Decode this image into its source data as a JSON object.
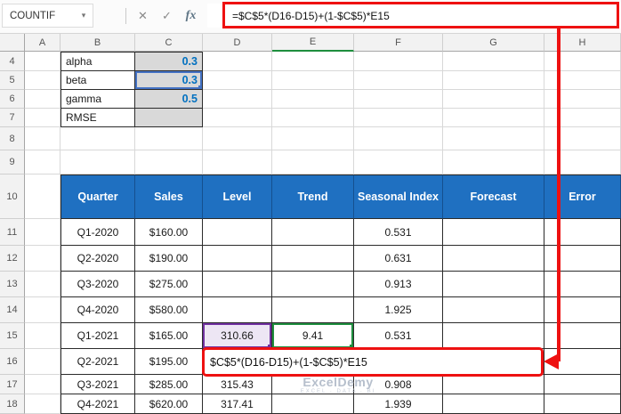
{
  "name_box": {
    "value": "COUNTIF",
    "dropdown_icon": "▾"
  },
  "formula_bar": {
    "cancel_icon": "✕",
    "enter_icon": "✓",
    "fx_icon": "fx",
    "formula": "=$C$5*(D16-D15)+(1-$C$5)*E15"
  },
  "sheet": {
    "column_headers": [
      "A",
      "B",
      "C",
      "D",
      "E",
      "F",
      "G",
      "H"
    ],
    "row_numbers": [
      "4",
      "5",
      "6",
      "7",
      "8",
      "9",
      "10",
      "11",
      "12",
      "13",
      "14",
      "15",
      "16",
      "17",
      "18"
    ],
    "params": [
      {
        "label": "alpha",
        "value": "0.3"
      },
      {
        "label": "beta",
        "value": "0.3"
      },
      {
        "label": "gamma",
        "value": "0.5"
      },
      {
        "label": "RMSE",
        "value": ""
      }
    ],
    "table": {
      "headers": [
        "Quarter",
        "Sales",
        "Level",
        "Trend",
        "Seasonal Index",
        "Forecast",
        "Error"
      ],
      "rows": [
        {
          "quarter": "Q1-2020",
          "sales": "$160.00",
          "level": "",
          "trend": "",
          "seasonal": "0.531",
          "forecast": "",
          "error": ""
        },
        {
          "quarter": "Q2-2020",
          "sales": "$190.00",
          "level": "",
          "trend": "",
          "seasonal": "0.631",
          "forecast": "",
          "error": ""
        },
        {
          "quarter": "Q3-2020",
          "sales": "$275.00",
          "level": "",
          "trend": "",
          "seasonal": "0.913",
          "forecast": "",
          "error": ""
        },
        {
          "quarter": "Q4-2020",
          "sales": "$580.00",
          "level": "",
          "trend": "",
          "seasonal": "1.925",
          "forecast": "",
          "error": ""
        },
        {
          "quarter": "Q1-2021",
          "sales": "$165.00",
          "level": "310.66",
          "trend": "9.41",
          "seasonal": "0.531",
          "forecast": "",
          "error": ""
        },
        {
          "quarter": "Q2-2021",
          "sales": "$195.00",
          "level": "",
          "trend": "",
          "seasonal": "",
          "forecast": "",
          "error": ""
        },
        {
          "quarter": "Q3-2021",
          "sales": "$285.00",
          "level": "315.43",
          "trend": "",
          "seasonal": "0.908",
          "forecast": "",
          "error": ""
        },
        {
          "quarter": "Q4-2021",
          "sales": "$620.00",
          "level": "317.41",
          "trend": "",
          "seasonal": "1.939",
          "forecast": "",
          "error": ""
        }
      ]
    }
  },
  "annotation": {
    "cell_formula": "$C$5*(D16-D15)+(1-$C$5)*E15"
  },
  "watermark": {
    "line1": "ExcelDemy",
    "line2": "EXCEL · DATA · BI"
  },
  "colors": {
    "table_header_blue": "#1F70C1",
    "param_value_blue": "#0070C0",
    "annotation_red": "#EE1111",
    "reference_blue": "#4472C4",
    "reference_purple": "#7030A0",
    "reference_green": "#1E8E3E",
    "param_fill_gray": "#D9D9D9"
  }
}
